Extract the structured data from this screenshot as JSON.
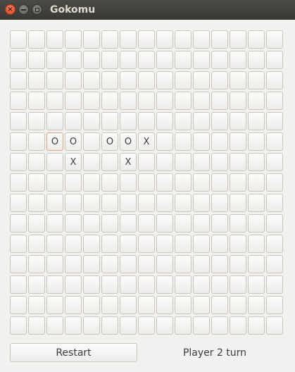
{
  "window": {
    "title": "Gokomu",
    "controls": {
      "close": "×",
      "minimize": "",
      "maximize": ""
    }
  },
  "board": {
    "size": 15,
    "last_move": {
      "row": 5,
      "col": 2
    },
    "rows": [
      [
        "",
        "",
        "",
        "",
        "",
        "",
        "",
        "",
        "",
        "",
        "",
        "",
        "",
        "",
        ""
      ],
      [
        "",
        "",
        "",
        "",
        "",
        "",
        "",
        "",
        "",
        "",
        "",
        "",
        "",
        "",
        ""
      ],
      [
        "",
        "",
        "",
        "",
        "",
        "",
        "",
        "",
        "",
        "",
        "",
        "",
        "",
        "",
        ""
      ],
      [
        "",
        "",
        "",
        "",
        "",
        "",
        "",
        "",
        "",
        "",
        "",
        "",
        "",
        "",
        ""
      ],
      [
        "",
        "",
        "",
        "",
        "",
        "",
        "",
        "",
        "",
        "",
        "",
        "",
        "",
        "",
        ""
      ],
      [
        "",
        "",
        "O",
        "O",
        "",
        "O",
        "O",
        "X",
        "",
        "",
        "",
        "",
        "",
        "",
        ""
      ],
      [
        "",
        "",
        "",
        "X",
        "",
        "",
        "X",
        "",
        "",
        "",
        "",
        "",
        "",
        "",
        ""
      ],
      [
        "",
        "",
        "",
        "",
        "",
        "",
        "",
        "",
        "",
        "",
        "",
        "",
        "",
        "",
        ""
      ],
      [
        "",
        "",
        "",
        "",
        "",
        "",
        "",
        "",
        "",
        "",
        "",
        "",
        "",
        "",
        ""
      ],
      [
        "",
        "",
        "",
        "",
        "",
        "",
        "",
        "",
        "",
        "",
        "",
        "",
        "",
        "",
        ""
      ],
      [
        "",
        "",
        "",
        "",
        "",
        "",
        "",
        "",
        "",
        "",
        "",
        "",
        "",
        "",
        ""
      ],
      [
        "",
        "",
        "",
        "",
        "",
        "",
        "",
        "",
        "",
        "",
        "",
        "",
        "",
        "",
        ""
      ],
      [
        "",
        "",
        "",
        "",
        "",
        "",
        "",
        "",
        "",
        "",
        "",
        "",
        "",
        "",
        ""
      ],
      [
        "",
        "",
        "",
        "",
        "",
        "",
        "",
        "",
        "",
        "",
        "",
        "",
        "",
        "",
        ""
      ],
      [
        "",
        "",
        "",
        "",
        "",
        "",
        "",
        "",
        "",
        "",
        "",
        "",
        "",
        "",
        ""
      ]
    ]
  },
  "footer": {
    "restart_label": "Restart",
    "status_text": "Player 2 turn"
  }
}
